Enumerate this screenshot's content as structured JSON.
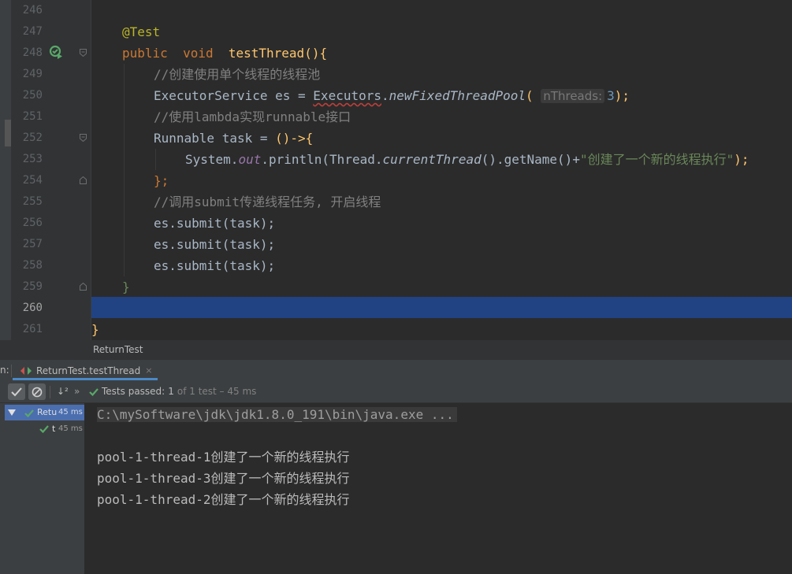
{
  "editor": {
    "line_numbers": [
      "246",
      "247",
      "248",
      "249",
      "250",
      "251",
      "252",
      "253",
      "254",
      "255",
      "256",
      "257",
      "258",
      "259",
      "260",
      "261"
    ],
    "code": {
      "l247_annotation": "@Test",
      "l248_kw_public": "public",
      "l248_kw_void": "void",
      "l248_method": "testThread",
      "l248_rest": "(){",
      "l249_comment": "//创建使用单个线程的线程池",
      "l250_type": "ExecutorService es = ",
      "l250_class": "Executors",
      "l250_dot": ".",
      "l250_method": "newFixedThreadPool",
      "l250_open": "(",
      "l250_hint": "nThreads:",
      "l250_num": "3",
      "l250_close": ");",
      "l251_comment": "//使用lambda实现runnable接口",
      "l252_text": "Runnable task = ",
      "l252_lambda": "()->{",
      "l253_system": "System.",
      "l253_out": "out",
      "l253_println": ".println(",
      "l253_thread": "Thread.",
      "l253_current": "currentThread",
      "l253_getname": "().getName()+",
      "l253_str": "\"创建了一个新的线程执行\"",
      "l253_end": ");",
      "l254_close": "};",
      "l255_comment": "//调用submit传递线程任务, 开启线程",
      "l256": "es.submit(task);",
      "l257": "es.submit(task);",
      "l258": "es.submit(task);",
      "l259": "}",
      "l261": "}"
    }
  },
  "breadcrumb": "ReturnTest",
  "run_window": {
    "label": "n:",
    "tab_title": "ReturnTest.testThread",
    "close_glyph": "×",
    "sort_glyph": "↓²",
    "expand_glyph": "»",
    "status_prefix": "Tests passed:",
    "status_count": "1",
    "status_suffix": "of 1 test – 45 ms",
    "tree": [
      {
        "label": "Retu",
        "time": "45 ms"
      },
      {
        "label": "t",
        "time": "45 ms"
      }
    ],
    "console": [
      "C:\\mySoftware\\jdk\\jdk1.8.0_191\\bin\\java.exe ...",
      "pool-1-thread-1创建了一个新的线程执行",
      "pool-1-thread-3创建了一个新的线程执行",
      "pool-1-thread-2创建了一个新的线程执行"
    ]
  },
  "colors": {
    "background": "#2b2b2b",
    "keyword": "#cc7832",
    "method": "#ffc66d",
    "comment": "#808080",
    "string": "#6a8759",
    "number": "#6897bb",
    "field": "#9876aa",
    "annotation": "#bbb529",
    "selection": "#214283",
    "pass_green": "#59a869"
  }
}
